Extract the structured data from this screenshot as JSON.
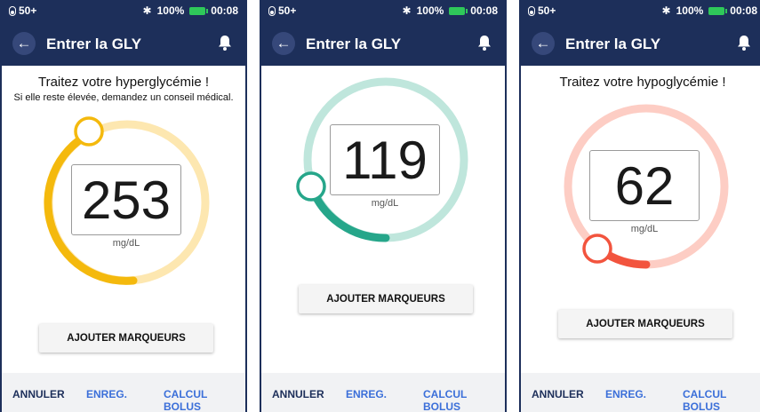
{
  "screens": [
    {
      "status": {
        "insulin": "50+",
        "battery": "100%",
        "time": "00:08"
      },
      "title": "Entrer la GLY",
      "message": "Traitez votre hyperglycémie !",
      "submessage": "Si elle reste élevée, demandez un conseil médical.",
      "value": "253",
      "unit": "mg/dL",
      "markers_label": "AJOUTER MARQUEURS",
      "footer": {
        "cancel": "ANNULER",
        "save": "ENREG.",
        "bolus": "CALCUL BOLUS"
      },
      "colors": {
        "track": "#fde7b0",
        "active": "#f4b90d"
      }
    },
    {
      "status": {
        "insulin": "50+",
        "battery": "100%",
        "time": "00:08"
      },
      "title": "Entrer la GLY",
      "value": "119",
      "unit": "mg/dL",
      "markers_label": "AJOUTER MARQUEURS",
      "footer": {
        "cancel": "ANNULER",
        "save": "ENREG.",
        "bolus": "CALCUL BOLUS"
      },
      "colors": {
        "track": "#bfe6dc",
        "active": "#26a68a"
      }
    },
    {
      "status": {
        "insulin": "50+",
        "battery": "100%",
        "time": "00:08"
      },
      "title": "Entrer la GLY",
      "message": "Traitez votre hypoglycémie !",
      "value": "62",
      "unit": "mg/dL",
      "markers_label": "AJOUTER MARQUEURS",
      "footer": {
        "cancel": "ANNULER",
        "save": "ENREG.",
        "bolus": "CALCUL BOLUS"
      },
      "colors": {
        "track": "#fdcdc4",
        "active": "#f2543e"
      }
    }
  ]
}
